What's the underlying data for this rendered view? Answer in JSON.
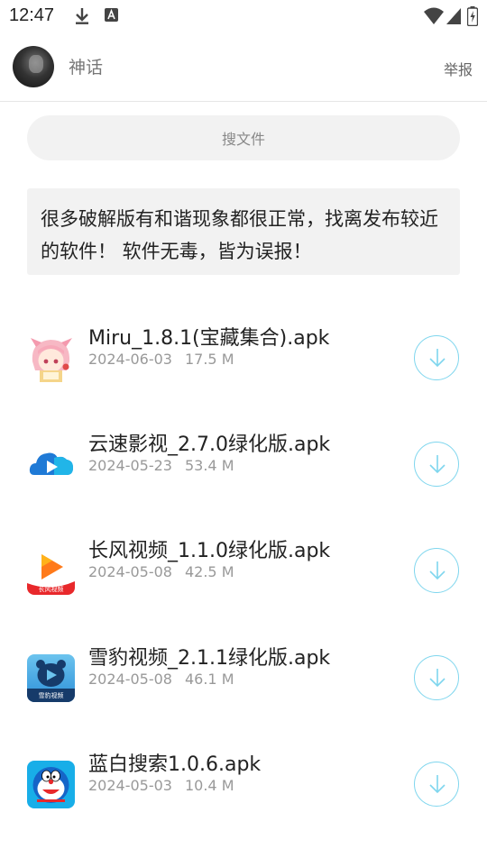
{
  "status_bar": {
    "time": "12:47",
    "icons": [
      "download-icon",
      "text-a-icon",
      "wifi-icon",
      "cell-signal-icon",
      "battery-charging-icon"
    ]
  },
  "header": {
    "author": "神话",
    "report_label": "举报"
  },
  "search": {
    "placeholder": "搜文件"
  },
  "notice": {
    "text": "很多破解版有和谐现象都很正常，找离发布较近的软件！ 软件无毒，皆为误报！"
  },
  "files": [
    {
      "name": "Miru_1.8.1(宝藏集合).apk",
      "date": "2024-06-03",
      "size": "17.5 M",
      "icon": "anime-girl-icon"
    },
    {
      "name": "云速影视_2.7.0绿化版.apk",
      "date": "2024-05-23",
      "size": "53.4 M",
      "icon": "cloud-play-icon"
    },
    {
      "name": "长风视频_1.1.0绿化版.apk",
      "date": "2024-05-08",
      "size": "42.5 M",
      "icon": "changfeng-play-icon",
      "icon_label": "长风视频"
    },
    {
      "name": "雪豹视频_2.1.1绿化版.apk",
      "date": "2024-05-08",
      "size": "46.1 M",
      "icon": "snow-leopard-icon",
      "icon_label": "雪豹视频"
    },
    {
      "name": "蓝白搜索1.0.6.apk",
      "date": "2024-05-03",
      "size": "10.4 M",
      "icon": "doraemon-icon"
    }
  ],
  "colors": {
    "accent": "#7fd6ee",
    "meta_text": "#999999",
    "notice_bg": "#f2f2f2"
  }
}
